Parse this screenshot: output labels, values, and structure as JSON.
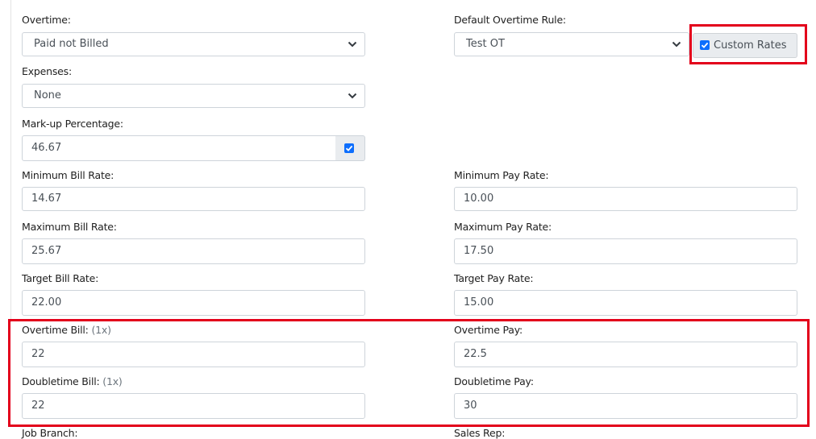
{
  "overtime": {
    "label": "Overtime:",
    "value": "Paid not Billed"
  },
  "default_overtime_rule": {
    "label": "Default Overtime Rule:",
    "value": "Test OT"
  },
  "custom_rates": {
    "label": "Custom Rates",
    "checked": true
  },
  "expenses": {
    "label": "Expenses:",
    "value": "None"
  },
  "markup": {
    "label": "Mark-up Percentage:",
    "value": "46.67",
    "checked": true
  },
  "min_bill": {
    "label": "Minimum Bill Rate:",
    "value": "14.67"
  },
  "min_pay": {
    "label": "Minimum Pay Rate:",
    "value": "10.00"
  },
  "max_bill": {
    "label": "Maximum Bill Rate:",
    "value": "25.67"
  },
  "max_pay": {
    "label": "Maximum Pay Rate:",
    "value": "17.50"
  },
  "target_bill": {
    "label": "Target Bill Rate:",
    "value": "22.00"
  },
  "target_pay": {
    "label": "Target Pay Rate:",
    "value": "15.00"
  },
  "overtime_bill": {
    "label": "Overtime Bill:",
    "multiplier": "(1x)",
    "value": "22"
  },
  "overtime_pay": {
    "label": "Overtime Pay:",
    "value": "22.5"
  },
  "doubletime_bill": {
    "label": "Doubletime Bill:",
    "multiplier": "(1x)",
    "value": "22"
  },
  "doubletime_pay": {
    "label": "Doubletime Pay:",
    "value": "30"
  },
  "job_branch": {
    "label": "Job Branch:"
  },
  "sales_rep": {
    "label": "Sales Rep:"
  },
  "colors": {
    "highlight": "#e3001b",
    "checkbox": "#0d6efd",
    "addon_bg": "#e9ecef"
  }
}
